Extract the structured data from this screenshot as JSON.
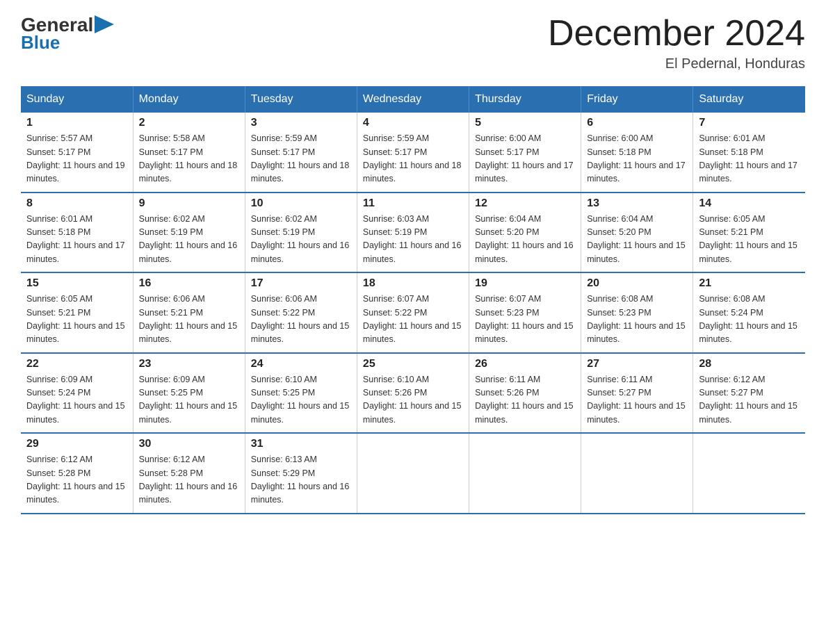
{
  "logo": {
    "general": "General",
    "blue": "Blue",
    "arrow": "▶"
  },
  "header": {
    "month_title": "December 2024",
    "location": "El Pedernal, Honduras"
  },
  "days_of_week": [
    "Sunday",
    "Monday",
    "Tuesday",
    "Wednesday",
    "Thursday",
    "Friday",
    "Saturday"
  ],
  "weeks": [
    [
      {
        "day": "1",
        "sunrise": "Sunrise: 5:57 AM",
        "sunset": "Sunset: 5:17 PM",
        "daylight": "Daylight: 11 hours and 19 minutes."
      },
      {
        "day": "2",
        "sunrise": "Sunrise: 5:58 AM",
        "sunset": "Sunset: 5:17 PM",
        "daylight": "Daylight: 11 hours and 18 minutes."
      },
      {
        "day": "3",
        "sunrise": "Sunrise: 5:59 AM",
        "sunset": "Sunset: 5:17 PM",
        "daylight": "Daylight: 11 hours and 18 minutes."
      },
      {
        "day": "4",
        "sunrise": "Sunrise: 5:59 AM",
        "sunset": "Sunset: 5:17 PM",
        "daylight": "Daylight: 11 hours and 18 minutes."
      },
      {
        "day": "5",
        "sunrise": "Sunrise: 6:00 AM",
        "sunset": "Sunset: 5:17 PM",
        "daylight": "Daylight: 11 hours and 17 minutes."
      },
      {
        "day": "6",
        "sunrise": "Sunrise: 6:00 AM",
        "sunset": "Sunset: 5:18 PM",
        "daylight": "Daylight: 11 hours and 17 minutes."
      },
      {
        "day": "7",
        "sunrise": "Sunrise: 6:01 AM",
        "sunset": "Sunset: 5:18 PM",
        "daylight": "Daylight: 11 hours and 17 minutes."
      }
    ],
    [
      {
        "day": "8",
        "sunrise": "Sunrise: 6:01 AM",
        "sunset": "Sunset: 5:18 PM",
        "daylight": "Daylight: 11 hours and 17 minutes."
      },
      {
        "day": "9",
        "sunrise": "Sunrise: 6:02 AM",
        "sunset": "Sunset: 5:19 PM",
        "daylight": "Daylight: 11 hours and 16 minutes."
      },
      {
        "day": "10",
        "sunrise": "Sunrise: 6:02 AM",
        "sunset": "Sunset: 5:19 PM",
        "daylight": "Daylight: 11 hours and 16 minutes."
      },
      {
        "day": "11",
        "sunrise": "Sunrise: 6:03 AM",
        "sunset": "Sunset: 5:19 PM",
        "daylight": "Daylight: 11 hours and 16 minutes."
      },
      {
        "day": "12",
        "sunrise": "Sunrise: 6:04 AM",
        "sunset": "Sunset: 5:20 PM",
        "daylight": "Daylight: 11 hours and 16 minutes."
      },
      {
        "day": "13",
        "sunrise": "Sunrise: 6:04 AM",
        "sunset": "Sunset: 5:20 PM",
        "daylight": "Daylight: 11 hours and 15 minutes."
      },
      {
        "day": "14",
        "sunrise": "Sunrise: 6:05 AM",
        "sunset": "Sunset: 5:21 PM",
        "daylight": "Daylight: 11 hours and 15 minutes."
      }
    ],
    [
      {
        "day": "15",
        "sunrise": "Sunrise: 6:05 AM",
        "sunset": "Sunset: 5:21 PM",
        "daylight": "Daylight: 11 hours and 15 minutes."
      },
      {
        "day": "16",
        "sunrise": "Sunrise: 6:06 AM",
        "sunset": "Sunset: 5:21 PM",
        "daylight": "Daylight: 11 hours and 15 minutes."
      },
      {
        "day": "17",
        "sunrise": "Sunrise: 6:06 AM",
        "sunset": "Sunset: 5:22 PM",
        "daylight": "Daylight: 11 hours and 15 minutes."
      },
      {
        "day": "18",
        "sunrise": "Sunrise: 6:07 AM",
        "sunset": "Sunset: 5:22 PM",
        "daylight": "Daylight: 11 hours and 15 minutes."
      },
      {
        "day": "19",
        "sunrise": "Sunrise: 6:07 AM",
        "sunset": "Sunset: 5:23 PM",
        "daylight": "Daylight: 11 hours and 15 minutes."
      },
      {
        "day": "20",
        "sunrise": "Sunrise: 6:08 AM",
        "sunset": "Sunset: 5:23 PM",
        "daylight": "Daylight: 11 hours and 15 minutes."
      },
      {
        "day": "21",
        "sunrise": "Sunrise: 6:08 AM",
        "sunset": "Sunset: 5:24 PM",
        "daylight": "Daylight: 11 hours and 15 minutes."
      }
    ],
    [
      {
        "day": "22",
        "sunrise": "Sunrise: 6:09 AM",
        "sunset": "Sunset: 5:24 PM",
        "daylight": "Daylight: 11 hours and 15 minutes."
      },
      {
        "day": "23",
        "sunrise": "Sunrise: 6:09 AM",
        "sunset": "Sunset: 5:25 PM",
        "daylight": "Daylight: 11 hours and 15 minutes."
      },
      {
        "day": "24",
        "sunrise": "Sunrise: 6:10 AM",
        "sunset": "Sunset: 5:25 PM",
        "daylight": "Daylight: 11 hours and 15 minutes."
      },
      {
        "day": "25",
        "sunrise": "Sunrise: 6:10 AM",
        "sunset": "Sunset: 5:26 PM",
        "daylight": "Daylight: 11 hours and 15 minutes."
      },
      {
        "day": "26",
        "sunrise": "Sunrise: 6:11 AM",
        "sunset": "Sunset: 5:26 PM",
        "daylight": "Daylight: 11 hours and 15 minutes."
      },
      {
        "day": "27",
        "sunrise": "Sunrise: 6:11 AM",
        "sunset": "Sunset: 5:27 PM",
        "daylight": "Daylight: 11 hours and 15 minutes."
      },
      {
        "day": "28",
        "sunrise": "Sunrise: 6:12 AM",
        "sunset": "Sunset: 5:27 PM",
        "daylight": "Daylight: 11 hours and 15 minutes."
      }
    ],
    [
      {
        "day": "29",
        "sunrise": "Sunrise: 6:12 AM",
        "sunset": "Sunset: 5:28 PM",
        "daylight": "Daylight: 11 hours and 15 minutes."
      },
      {
        "day": "30",
        "sunrise": "Sunrise: 6:12 AM",
        "sunset": "Sunset: 5:28 PM",
        "daylight": "Daylight: 11 hours and 16 minutes."
      },
      {
        "day": "31",
        "sunrise": "Sunrise: 6:13 AM",
        "sunset": "Sunset: 5:29 PM",
        "daylight": "Daylight: 11 hours and 16 minutes."
      },
      null,
      null,
      null,
      null
    ]
  ]
}
